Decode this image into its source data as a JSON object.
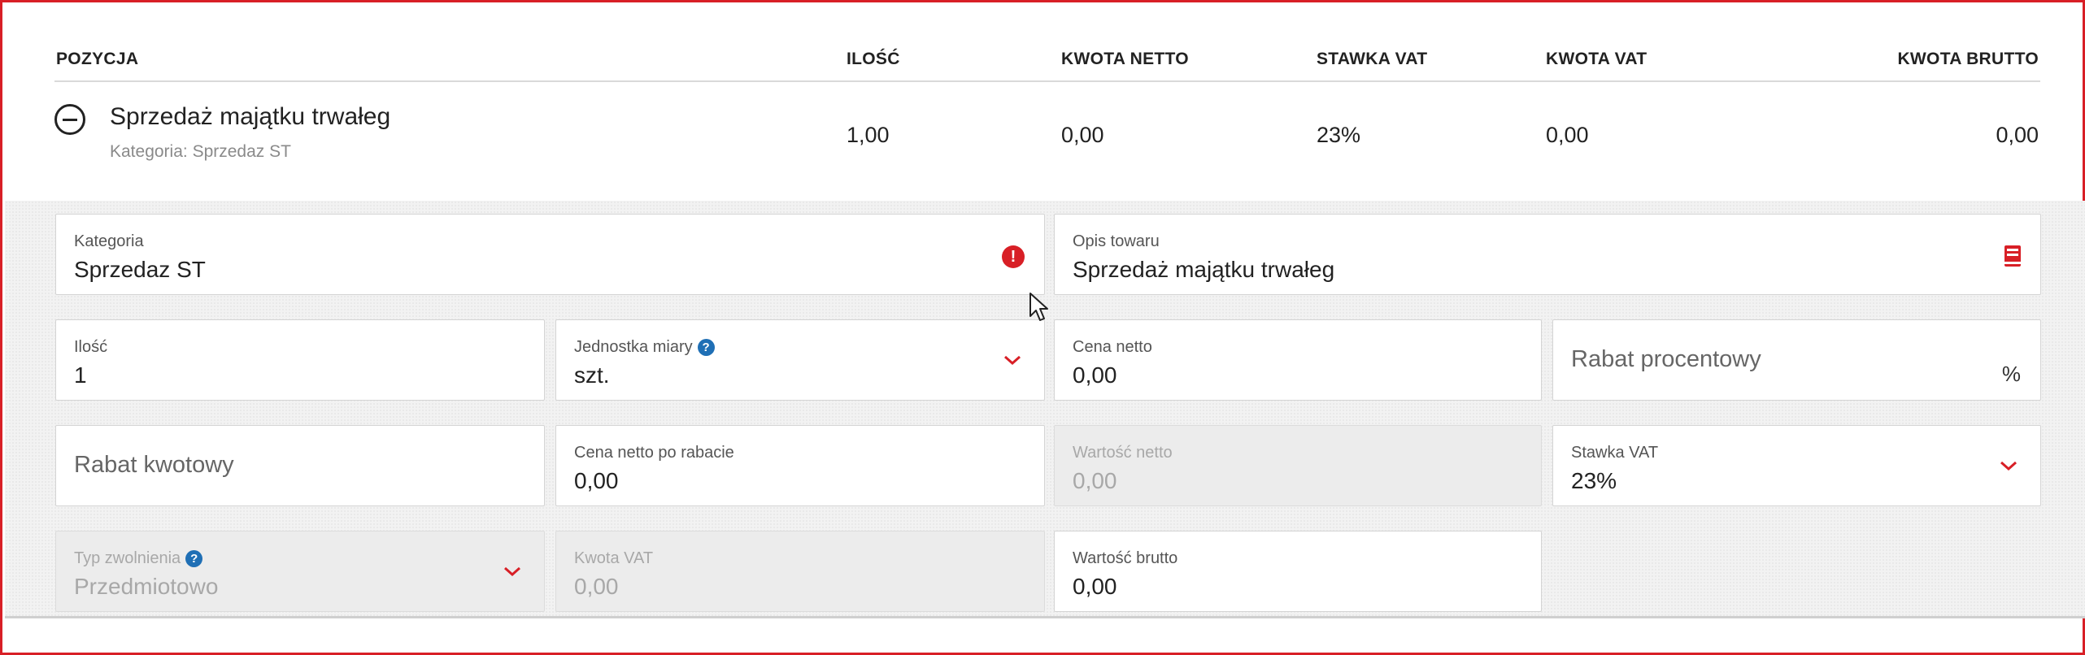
{
  "table": {
    "headers": {
      "position": "POZYCJA",
      "quantity": "ILOŚĆ",
      "net": "KWOTA NETTO",
      "vat_rate": "STAWKA VAT",
      "vat_amount": "KWOTA VAT",
      "gross": "KWOTA BRUTTO"
    },
    "row": {
      "name": "Sprzedaż majątku trwałeg",
      "category": "Kategoria: Sprzedaz ST",
      "quantity": "1,00",
      "net": "0,00",
      "vat_rate": "23%",
      "vat_amount": "0,00",
      "gross": "0,00"
    }
  },
  "form": {
    "kategoria": {
      "label": "Kategoria",
      "value": "Sprzedaz ST",
      "error_icon": "exclamation-icon"
    },
    "opis": {
      "label": "Opis towaru",
      "value": "Sprzedaż majątku trwałeg",
      "icon": "book-icon"
    },
    "ilosc": {
      "label": "Ilość",
      "value": "1"
    },
    "jednostka": {
      "label": "Jednostka miary",
      "value": "szt.",
      "help": "?"
    },
    "cena_netto": {
      "label": "Cena netto",
      "value": "0,00"
    },
    "rabat_procentowy": {
      "placeholder": "Rabat procentowy",
      "suffix": "%"
    },
    "rabat_kwotowy": {
      "placeholder": "Rabat kwotowy"
    },
    "cena_po_rabacie": {
      "label": "Cena netto po rabacie",
      "value": "0,00"
    },
    "wartosc_netto": {
      "label": "Wartość netto",
      "value": "0,00"
    },
    "stawka_vat": {
      "label": "Stawka VAT",
      "value": "23%"
    },
    "typ_zwolnienia": {
      "label": "Typ zwolnienia",
      "value": "Przedmiotowo",
      "help": "?"
    },
    "kwota_vat": {
      "label": "Kwota VAT",
      "value": "0,00"
    },
    "wartosc_brutto": {
      "label": "Wartość brutto",
      "value": "0,00"
    }
  },
  "colors": {
    "accent": "#d81f26",
    "help": "#1f6fb5",
    "disabled_bg": "#ececec"
  }
}
